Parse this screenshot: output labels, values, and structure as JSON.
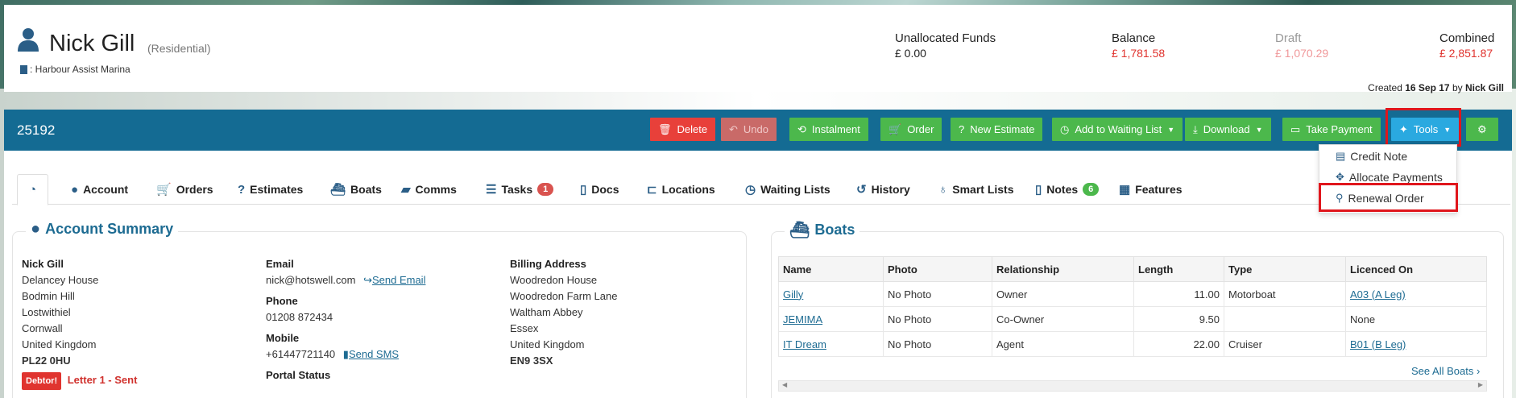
{
  "customer": {
    "name": "Nick Gill",
    "type": "(Residential)",
    "marina": ": Harbour Assist Marina"
  },
  "finance": {
    "unallocated_label": "Unallocated Funds",
    "unallocated_value": "£ 0.00",
    "balance_label": "Balance",
    "balance_value": "£ 1,781.58",
    "draft_label": "Draft",
    "draft_value": "£ 1,070.29",
    "combined_label": "Combined",
    "combined_value": "£ 2,851.87"
  },
  "created": {
    "prefix": "Created",
    "date": "16 Sep 17",
    "by": "by",
    "user": "Nick Gill"
  },
  "toolbar": {
    "account_number": "25192",
    "delete": "Delete",
    "undo": "Undo",
    "instalment": "Instalment",
    "order": "Order",
    "new_estimate": "New Estimate",
    "waiting_list": "Add to Waiting List",
    "download": "Download",
    "take_payment": "Take Payment",
    "tools": "Tools"
  },
  "tools_menu": {
    "credit_note": "Credit Note",
    "allocate_payments": "Allocate Payments",
    "renewal_order": "Renewal Order"
  },
  "tabs": {
    "account": "Account",
    "orders": "Orders",
    "estimates": "Estimates",
    "boats": "Boats",
    "comms": "Comms",
    "tasks": "Tasks",
    "tasks_count": "1",
    "docs": "Docs",
    "locations": "Locations",
    "waiting_lists": "Waiting Lists",
    "history": "History",
    "smart_lists": "Smart Lists",
    "notes": "Notes",
    "notes_count": "6",
    "features": "Features"
  },
  "account_summary": {
    "title": "Account Summary",
    "address": {
      "name": "Nick Gill",
      "line1": "Delancey House",
      "line2": "Bodmin Hill",
      "line3": "Lostwithiel",
      "line4": "Cornwall",
      "line5": "United Kingdom",
      "postcode": "PL22 0HU"
    },
    "email_label": "Email",
    "email": "nick@hotswell.com",
    "send_email": "Send Email",
    "phone_label": "Phone",
    "phone": "01208 872434",
    "mobile_label": "Mobile",
    "mobile": "+61447721140",
    "send_sms": "Send SMS",
    "portal_label": "Portal Status",
    "billing": {
      "label": "Billing Address",
      "line1": "Woodredon House",
      "line2": "Woodredon Farm Lane",
      "line3": "Waltham Abbey",
      "line4": "Essex",
      "line5": "United Kingdom",
      "postcode": "EN9 3SX"
    },
    "debtor_badge": "Debtor!",
    "letter_status": "Letter 1 - Sent"
  },
  "boats": {
    "title": "Boats",
    "columns": [
      "Name",
      "Photo",
      "Relationship",
      "Length",
      "Type",
      "Licenced On"
    ],
    "rows": [
      {
        "name": "Gilly",
        "photo": "No Photo",
        "relationship": "Owner",
        "length": "11.00",
        "type": "Motorboat",
        "licenced": "A03 (A Leg)"
      },
      {
        "name": "JEMIMA",
        "photo": "No Photo",
        "relationship": "Co-Owner",
        "length": "9.50",
        "type": "",
        "licenced": "None"
      },
      {
        "name": "IT Dream",
        "photo": "No Photo",
        "relationship": "Agent",
        "length": "22.00",
        "type": "Cruiser",
        "licenced": "B01 (B Leg)"
      }
    ],
    "see_all": "See All Boats"
  },
  "colors": {
    "toolbar_bg": "#146b93",
    "green_button": "#4cb84c",
    "red_button": "#e8403a",
    "tools_button": "#2aa9e0",
    "highlight": "#e0161c",
    "balance_red": "#e0342f",
    "draft_pink": "#f0989a"
  }
}
